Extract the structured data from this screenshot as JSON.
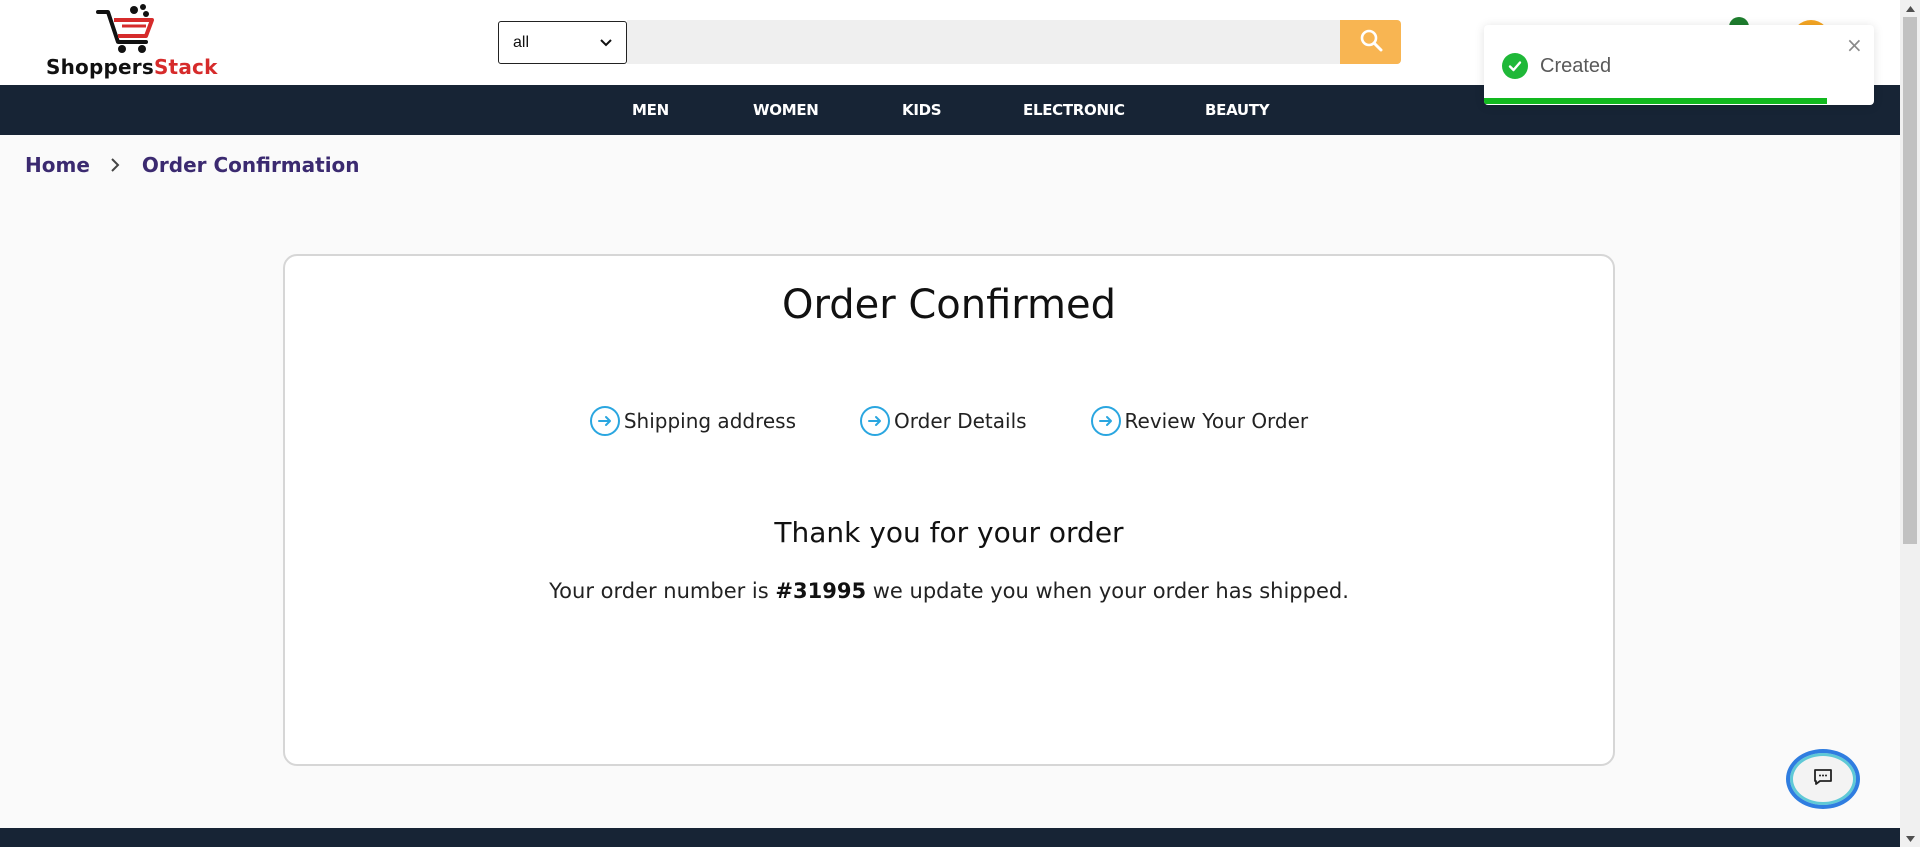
{
  "header": {
    "logo": {
      "part1": "Shoppers",
      "part2": "Stack"
    },
    "search": {
      "category": "all",
      "placeholder": ""
    }
  },
  "nav": {
    "items": [
      "MEN",
      "WOMEN",
      "KIDS",
      "ELECTRONIC",
      "BEAUTY"
    ]
  },
  "breadcrumb": {
    "home": "Home",
    "current": "Order Confirmation"
  },
  "confirmation": {
    "title": "Order Confirmed",
    "steps": [
      "Shipping address",
      "Order Details",
      "Review Your Order"
    ],
    "thanks": "Thank you for your order",
    "message_prefix": "Your order number is",
    "order_number": "#31995",
    "message_suffix": "we update you when your order has shipped."
  },
  "toast": {
    "message": "Created",
    "close": "×",
    "progress": 0.88
  },
  "colors": {
    "nav_bg": "#172435",
    "search_button": "#f8b552",
    "breadcrumb": "#3b2a70",
    "toast_success": "#1fb838",
    "step_icon": "#2aa6e0",
    "logo_red": "#d62b2b"
  },
  "icons": {
    "search": "search-icon",
    "step": "arrow-circle-right-icon",
    "toast": "check-circle-icon",
    "chat": "chat-bubble-icon",
    "breadcrumb_sep": "chevron-right-icon"
  }
}
